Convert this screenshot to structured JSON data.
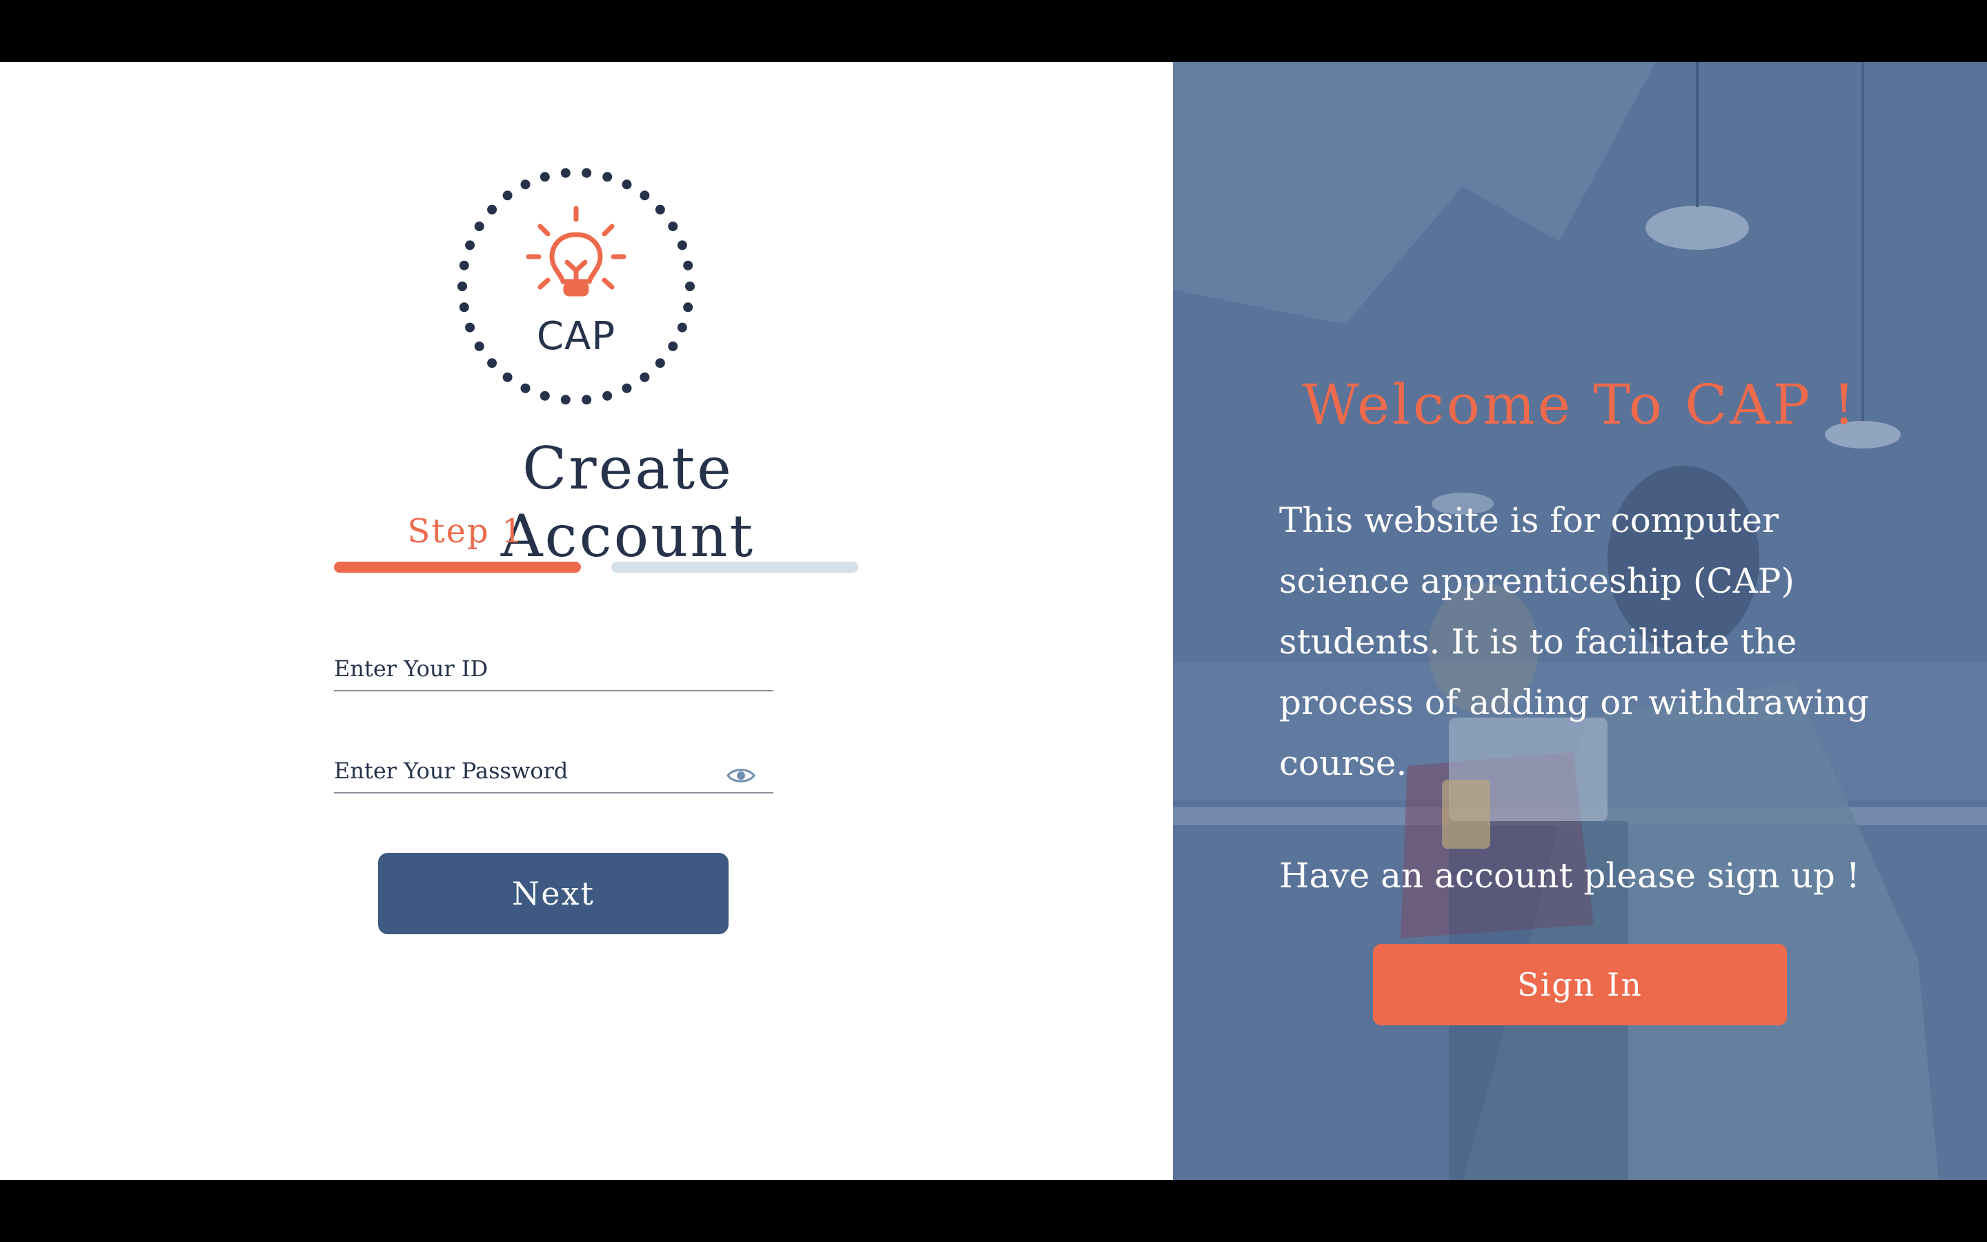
{
  "colors": {
    "accent": "#ee6a4c",
    "navy": "#25324a",
    "primary_button": "#3e5a82",
    "overlay": "#566f95",
    "inactive_step": "#d6e0e8"
  },
  "logo": {
    "text": "CAP",
    "icon": "lightbulb-icon"
  },
  "form": {
    "title": "Create Account",
    "step_label": "Step 1",
    "progress": {
      "current_step": 1,
      "total_steps": 2
    },
    "id_placeholder": "Enter Your ID",
    "password_placeholder": "Enter Your Password",
    "password_toggle_icon": "eye-icon",
    "next_label": "Next"
  },
  "welcome": {
    "title": "Welcome To CAP !",
    "description": "This website is for computer science apprenticeship (CAP) students. It is to facilitate the process of adding or withdrawing course.",
    "signup_prompt": "Have an account please sign up !",
    "signin_label": "Sign In"
  }
}
